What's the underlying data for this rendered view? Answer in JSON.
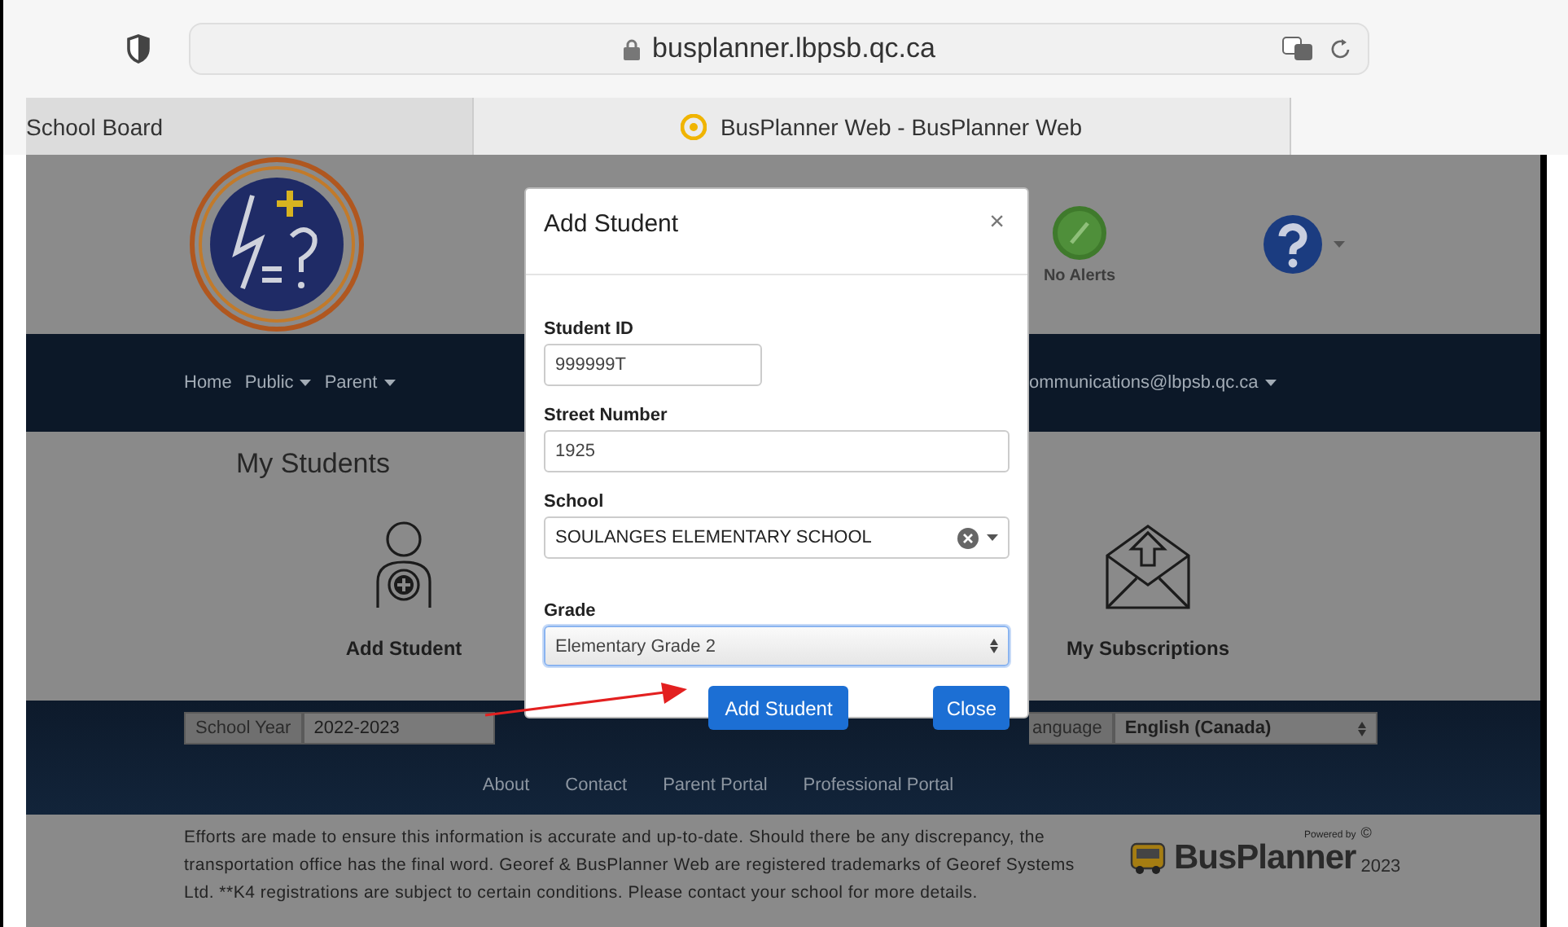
{
  "browser": {
    "url": "busplanner.lbpsb.qc.ca",
    "tabs": [
      {
        "title": "School Board",
        "selected": false
      },
      {
        "title": "BusPlanner Web - BusPlanner Web",
        "selected": true
      }
    ]
  },
  "header": {
    "alerts_label": "No Alerts"
  },
  "nav": {
    "items": [
      {
        "label": "Home",
        "dropdown": false
      },
      {
        "label": "Public",
        "dropdown": true
      },
      {
        "label": "Parent",
        "dropdown": true
      }
    ],
    "account": {
      "label": "ommunications@lbpsb.qc.ca",
      "dropdown": true
    }
  },
  "page": {
    "title": "My Students",
    "actions": [
      {
        "label": "Add Student",
        "kind": "add-student"
      },
      {
        "label": "My Subscriptions",
        "kind": "subscriptions"
      }
    ]
  },
  "footer": {
    "school_year": {
      "label": "School Year",
      "value": "2022-2023"
    },
    "language": {
      "label": "anguage",
      "value": "English (Canada)"
    },
    "links": [
      "About",
      "Contact",
      "Parent Portal",
      "Professional Portal"
    ],
    "disclaimer": "Efforts are made to ensure this information is accurate and up-to-date. Should there be any discrepancy, the transportation office has the final word. Georef & BusPlanner Web are registered trademarks of Georef Systems Ltd. **K4 registrations are subject to certain conditions. Please contact your school for more details.",
    "powered_by": "Powered by",
    "brand": "BusPlanner",
    "copyright": "©",
    "year": "2023"
  },
  "modal": {
    "title": "Add Student",
    "close": "×",
    "fields": [
      {
        "label": "Student ID",
        "kind": "short-text",
        "value": "999999T",
        "focused": false
      },
      {
        "label": "Street Number",
        "kind": "text",
        "value": "1925",
        "focused": false
      },
      {
        "label": "School",
        "kind": "combo",
        "value": "SOULANGES ELEMENTARY SCHOOL",
        "focused": false
      },
      {
        "label": "Grade",
        "kind": "select",
        "value": "Elementary Grade 2",
        "focused": true
      }
    ],
    "buttons": [
      {
        "label": "Add Student",
        "kind": "submit"
      },
      {
        "label": "Close",
        "kind": "dismiss"
      }
    ]
  }
}
